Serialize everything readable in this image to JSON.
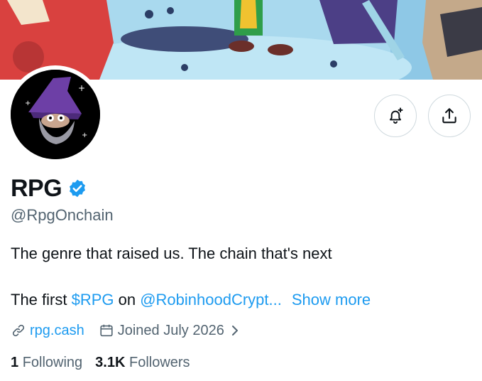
{
  "profile": {
    "display_name": "RPG",
    "handle": "@RpgOnchain",
    "bio_line1": "The genre that raised us. The chain that's next",
    "bio_line2_prefix": "The first ",
    "bio_cashtag": "$RPG",
    "bio_on": " on ",
    "bio_mention": "@RobinhoodCrypt...",
    "show_more": "Show more",
    "website": "rpg.cash",
    "joined": "Joined July 2026",
    "following_count": "1",
    "following_label": "Following",
    "followers_count": "3.1K",
    "followers_label": "Followers"
  },
  "icons": {
    "notify": "bell-plus-icon",
    "share": "share-icon",
    "verified": "verified-badge-icon",
    "link": "link-icon",
    "calendar": "calendar-icon",
    "chevron": "chevron-right-icon"
  },
  "colors": {
    "accent": "#1d9bf0",
    "text": "#0f1419",
    "secondary": "#536471",
    "border": "#cfd9de"
  }
}
